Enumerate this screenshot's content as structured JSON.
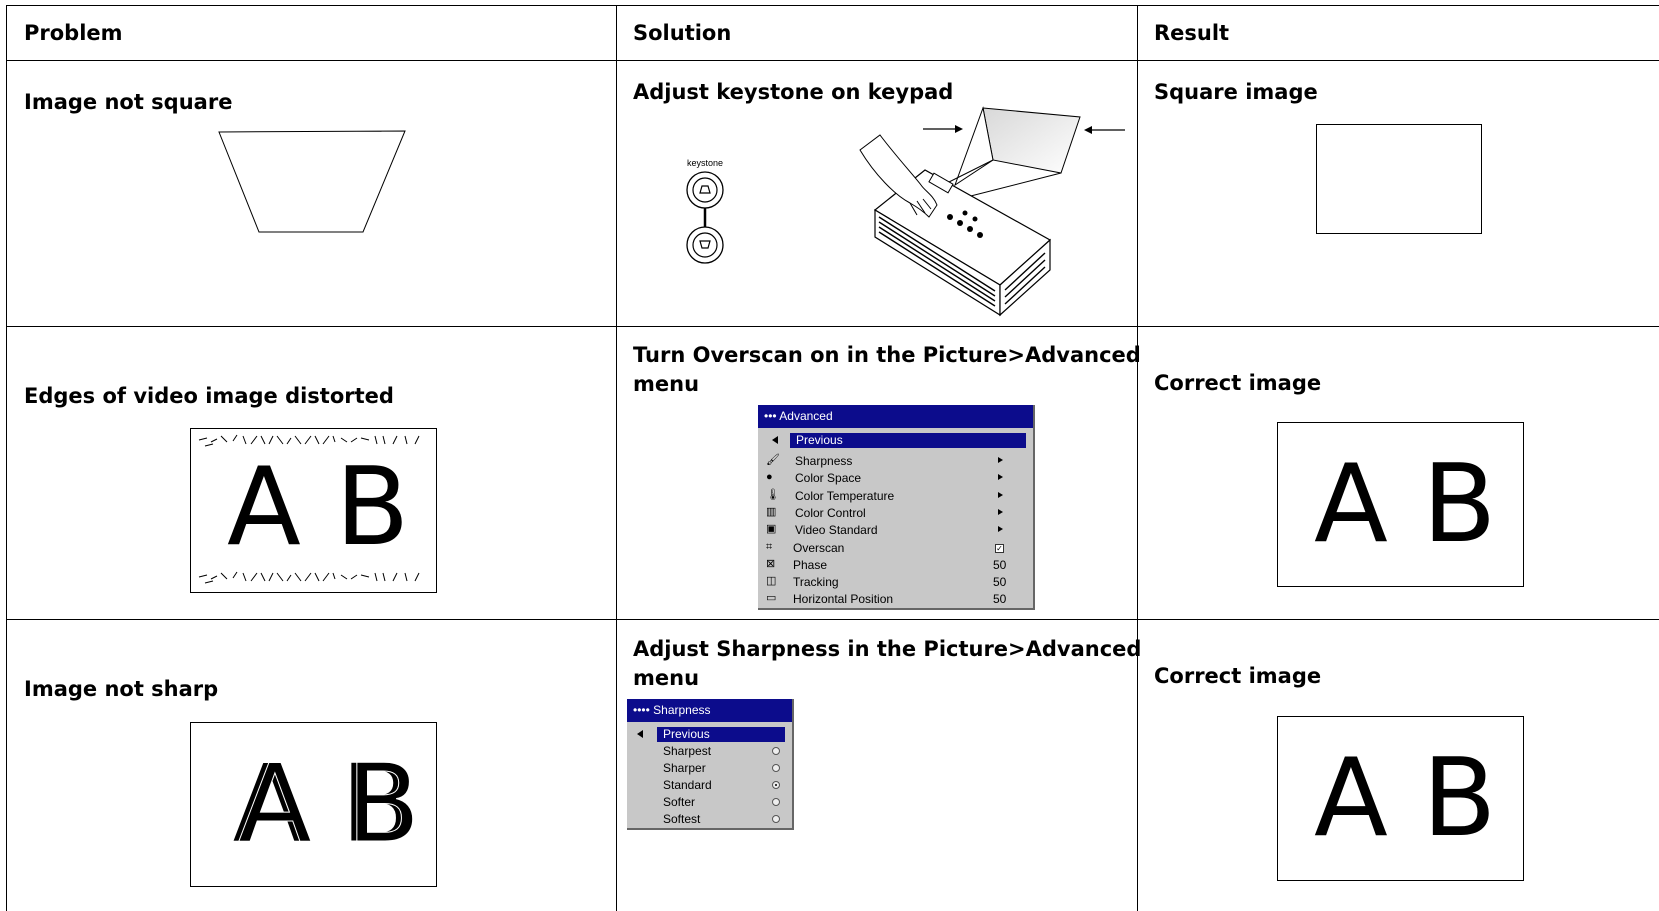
{
  "table": {
    "headers": [
      "Problem",
      "Solution",
      "Result"
    ],
    "rows": [
      {
        "problem": "Image not square",
        "solution": "Adjust keystone on keypad",
        "result": "Square image",
        "keypad_label": "keystone"
      },
      {
        "problem": "Edges of video image distorted",
        "solution_line1": "Turn Overscan on in the Picture>Advanced",
        "solution_line2": "menu",
        "result": "Correct image",
        "letters": "A B"
      },
      {
        "problem": "Image not sharp",
        "solution_line1": "Adjust Sharpness in the Picture>Advanced",
        "solution_line2": "menu",
        "result": "Correct image",
        "letters": "A B"
      }
    ]
  },
  "advanced_menu": {
    "title": "••• Advanced",
    "previous": "Previous",
    "items": [
      {
        "label": "Sharpness",
        "value": "",
        "control": "arrow",
        "icon": "paintbrush-icon"
      },
      {
        "label": "Color Space",
        "value": "",
        "control": "arrow",
        "icon": "color-dots-icon"
      },
      {
        "label": "Color Temperature",
        "value": "",
        "control": "arrow",
        "icon": "thermometer-icon"
      },
      {
        "label": "Color Control",
        "value": "",
        "control": "arrow",
        "icon": "color-bars-icon"
      },
      {
        "label": "Video Standard",
        "value": "",
        "control": "arrow",
        "icon": "video-standard-icon"
      },
      {
        "label": "Overscan",
        "value": "",
        "control": "checkbox-checked",
        "icon": "overscan-icon"
      },
      {
        "label": "Phase",
        "value": "50",
        "control": "value",
        "icon": "phase-icon"
      },
      {
        "label": "Tracking",
        "value": "50",
        "control": "value",
        "icon": "tracking-icon"
      },
      {
        "label": "Horizontal Position",
        "value": "50",
        "control": "value",
        "icon": "horizontal-position-icon"
      }
    ]
  },
  "sharpness_menu": {
    "title": "•••• Sharpness",
    "previous": "Previous",
    "options": [
      {
        "label": "Sharpest",
        "selected": false
      },
      {
        "label": "Sharper",
        "selected": false
      },
      {
        "label": "Standard",
        "selected": true
      },
      {
        "label": "Softer",
        "selected": false
      },
      {
        "label": "Softest",
        "selected": false
      }
    ]
  },
  "colors": {
    "menu_title_bg": "#0c0c8c",
    "menu_bg": "#c8c8c8",
    "border": "#000000"
  }
}
